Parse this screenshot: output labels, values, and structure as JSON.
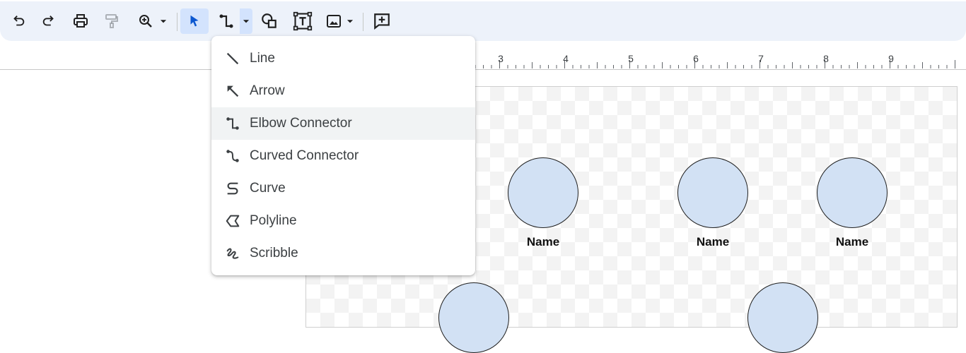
{
  "toolbar": {
    "buttons": [
      "undo-icon",
      "redo-icon",
      "print-icon",
      "paint-format-icon",
      "zoom-icon",
      "select-icon",
      "elbow-connector-icon",
      "shape-icon",
      "text-box-icon",
      "image-icon",
      "comment-icon"
    ]
  },
  "ruler": {
    "labels": [
      "3",
      "4",
      "5",
      "6",
      "7",
      "8",
      "9"
    ]
  },
  "menu": {
    "items": [
      {
        "label": "Line",
        "icon": "line-icon"
      },
      {
        "label": "Arrow",
        "icon": "arrow-icon"
      },
      {
        "label": "Elbow Connector",
        "icon": "elbow-connector-icon"
      },
      {
        "label": "Curved Connector",
        "icon": "curved-connector-icon"
      },
      {
        "label": "Curve",
        "icon": "curve-icon"
      },
      {
        "label": "Polyline",
        "icon": "polyline-icon"
      },
      {
        "label": "Scribble",
        "icon": "scribble-icon"
      }
    ],
    "highlighted": "Elbow Connector"
  },
  "canvas": {
    "nodes": [
      {
        "label": "Name"
      },
      {
        "label": "Name"
      },
      {
        "label": "Name"
      }
    ]
  },
  "colors": {
    "accent": "#d3e3fd",
    "toolbar_bg": "#edf2fa",
    "node_fill": "#d2e1f4"
  }
}
